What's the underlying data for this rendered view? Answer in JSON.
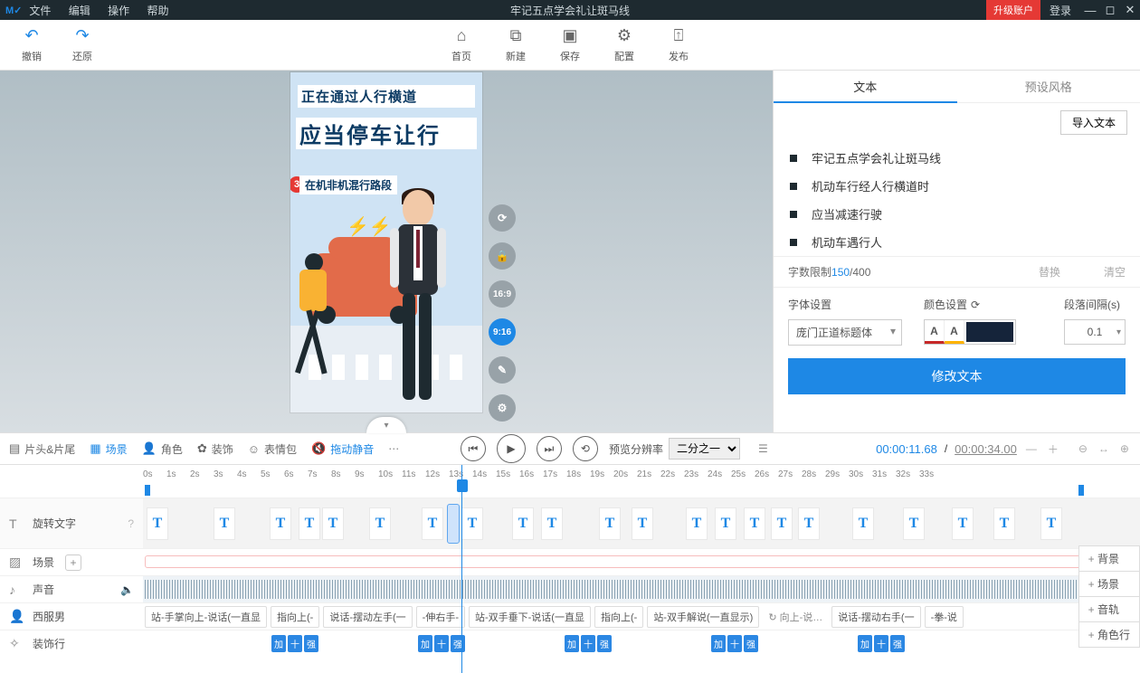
{
  "title": "牢记五点学会礼让斑马线",
  "menu": {
    "file": "文件",
    "edit": "编辑",
    "action": "操作",
    "help": "帮助"
  },
  "win": {
    "upgrade": "升级账户",
    "login": "登录"
  },
  "toolbar": {
    "undo": "撤销",
    "redo": "还原",
    "home": "首页",
    "new": "新建",
    "save": "保存",
    "config": "配置",
    "publish": "发布"
  },
  "stage": {
    "line1": "正在通过人行横道",
    "line2": "应当停车让行",
    "line3": "在机非机混行路段",
    "badge": "3"
  },
  "aspect": {
    "r1": "16:9",
    "r2": "9:16"
  },
  "panel": {
    "tab_text": "文本",
    "tab_preset": "预设风格",
    "import": "导入文本",
    "items": [
      "牢记五点学会礼让斑马线",
      "机动车行经人行横道时",
      "应当减速行驶",
      "机动车遇行人"
    ],
    "limit_label": "字数限制",
    "limit_cur": "150",
    "limit_max": " /400",
    "replace": "替换",
    "clear": "清空",
    "font_label": "字体设置",
    "color_label": "颜色设置",
    "gap_label": "段落间隔(s)",
    "font_value": "庞门正道标题体",
    "gap_value": "0.1",
    "apply": "修改文本"
  },
  "tabs": {
    "headtail": "片头&片尾",
    "scene": "场景",
    "role": "角色",
    "deco": "装饰",
    "emoji": "表情包",
    "dragmute": "拖动静音"
  },
  "play": {
    "rate_label": "预览分辨率",
    "rate_value": "二分之一"
  },
  "time": {
    "cur": "00:00:11.68",
    "sep": " / ",
    "total": "00:00:34.00"
  },
  "tracks": {
    "text": "旋转文字",
    "scene": "场景",
    "sound": "声音",
    "actor": "西服男",
    "deco": "装饰行"
  },
  "actor_segs": [
    "站-手掌向上-说话(一直显",
    "指向上(-",
    "说话-摆动左手(一",
    "-伸右手-",
    "站-双手垂下-说话(一直显",
    "指向上(-",
    "站-双手解说(一直显示)",
    "向上-说…",
    "说话-摆动右手(一",
    "-拳-说"
  ],
  "deco_chips": [
    "加",
    "十",
    "强"
  ],
  "addbtns": {
    "bg": "背景",
    "scene": "场景",
    "audio": "音轨",
    "role": "角色行"
  },
  "ruler": [
    "0s",
    "1s",
    "2s",
    "3s",
    "4s",
    "5s",
    "6s",
    "7s",
    "8s",
    "9s",
    "10s",
    "11s",
    "12s",
    "13s",
    "14s",
    "15s",
    "16s",
    "17s",
    "18s",
    "19s",
    "20s",
    "21s",
    "22s",
    "23s",
    "24s",
    "25s",
    "26s",
    "27s",
    "28s",
    "29s",
    "30s",
    "31s",
    "32s",
    "33s"
  ]
}
